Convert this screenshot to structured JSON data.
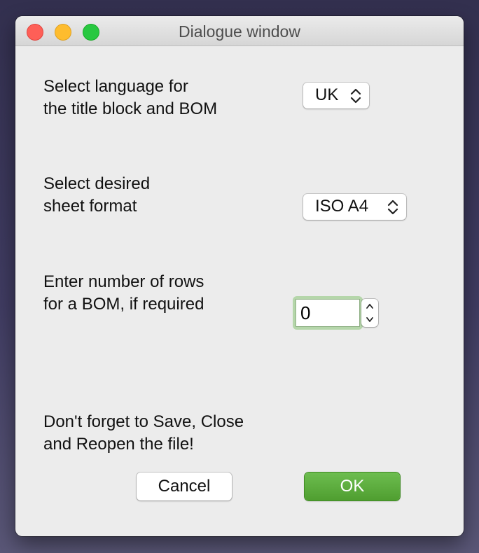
{
  "window": {
    "title": "Dialogue window"
  },
  "language": {
    "label_line1": "Select language for",
    "label_line2": "the title block and BOM",
    "selected": "UK"
  },
  "sheet_format": {
    "label_line1": "Select desired",
    "label_line2": "sheet format",
    "selected": "ISO A4"
  },
  "bom_rows": {
    "label_line1": "Enter number of rows",
    "label_line2": "for a BOM, if required",
    "value": "0"
  },
  "note": {
    "line1": "Don't forget to Save, Close",
    "line2": "and Reopen the file!"
  },
  "buttons": {
    "cancel_label": "Cancel",
    "ok_label": "OK"
  },
  "colors": {
    "accent_ok": "#55a535",
    "focus_ring": "#b5d6aa",
    "close": "#fe5f57",
    "minimize": "#febc2e",
    "zoom": "#28c840"
  },
  "icons": {
    "popup_arrows": "chevron-up-down-icon",
    "stepper_up": "chevron-up-icon",
    "stepper_down": "chevron-down-icon"
  }
}
